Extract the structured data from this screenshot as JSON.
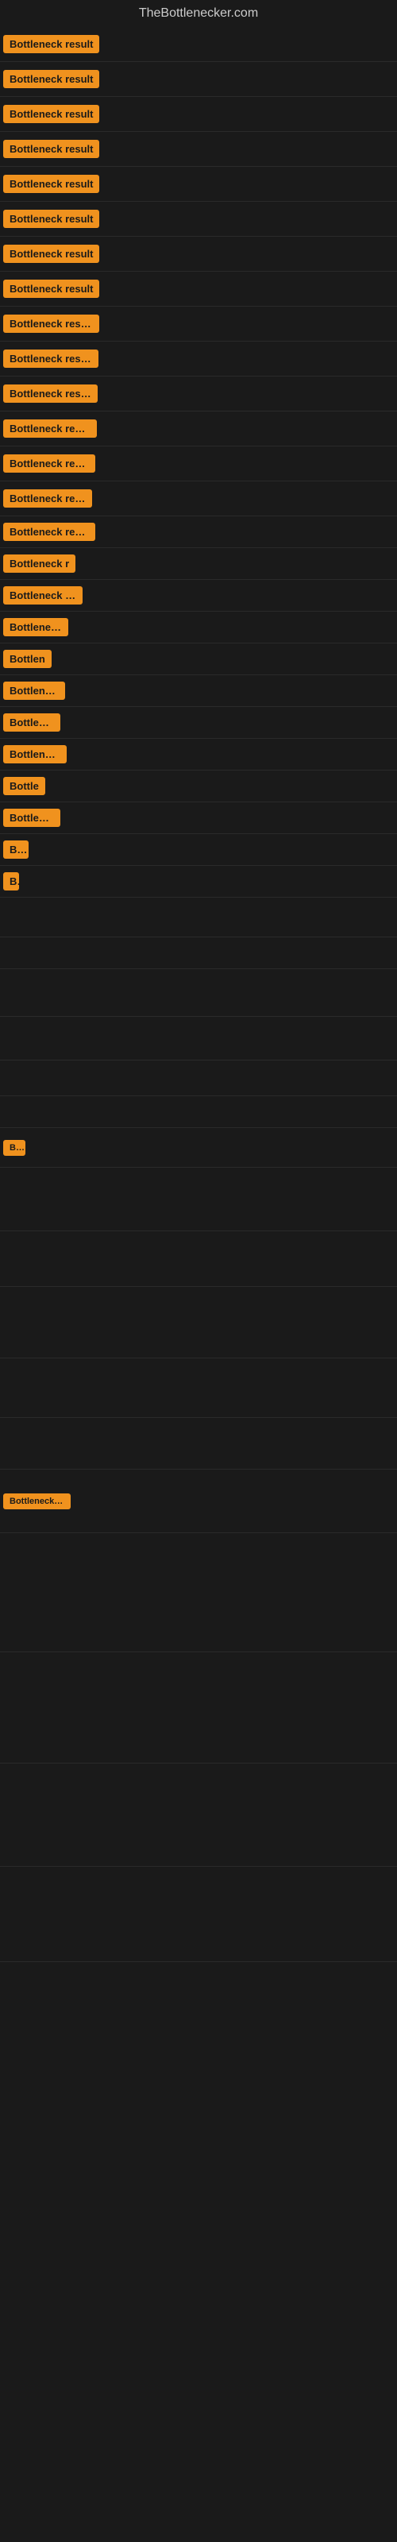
{
  "site": {
    "title": "TheBottlenecker.com"
  },
  "badge": {
    "label": "Bottleneck result",
    "color": "#f0921e"
  },
  "rows": [
    {
      "id": 1,
      "show_badge": true,
      "label": "Bottleneck result"
    },
    {
      "id": 2,
      "show_badge": true,
      "label": "Bottleneck result"
    },
    {
      "id": 3,
      "show_badge": true,
      "label": "Bottleneck result"
    },
    {
      "id": 4,
      "show_badge": true,
      "label": "Bottleneck result"
    },
    {
      "id": 5,
      "show_badge": true,
      "label": "Bottleneck result"
    },
    {
      "id": 6,
      "show_badge": true,
      "label": "Bottleneck result"
    },
    {
      "id": 7,
      "show_badge": true,
      "label": "Bottleneck result"
    },
    {
      "id": 8,
      "show_badge": true,
      "label": "Bottleneck result"
    },
    {
      "id": 9,
      "show_badge": true,
      "label": "Bottleneck result"
    },
    {
      "id": 10,
      "show_badge": true,
      "label": "Bottleneck result"
    },
    {
      "id": 11,
      "show_badge": true,
      "label": "Bottleneck result"
    },
    {
      "id": 12,
      "show_badge": true,
      "label": "Bottleneck result"
    },
    {
      "id": 13,
      "show_badge": true,
      "label": "Bottleneck result"
    },
    {
      "id": 14,
      "show_badge": true,
      "label": "Bottleneck result"
    },
    {
      "id": 15,
      "show_badge": true,
      "label": "Bottleneck result"
    },
    {
      "id": 16,
      "show_badge": true,
      "label": "Bottleneck r"
    },
    {
      "id": 17,
      "show_badge": true,
      "label": "Bottleneck resu"
    },
    {
      "id": 18,
      "show_badge": true,
      "label": "Bottleneck"
    },
    {
      "id": 19,
      "show_badge": true,
      "label": "Bottlen"
    },
    {
      "id": 20,
      "show_badge": true,
      "label": "Bottleneck"
    },
    {
      "id": 21,
      "show_badge": true,
      "label": "Bottlenec"
    },
    {
      "id": 22,
      "show_badge": true,
      "label": "Bottleneck r"
    },
    {
      "id": 23,
      "show_badge": true,
      "label": "Bottle"
    },
    {
      "id": 24,
      "show_badge": true,
      "label": "Bottleneck"
    },
    {
      "id": 25,
      "show_badge": true,
      "label": "Bo"
    },
    {
      "id": 26,
      "show_badge": true,
      "label": "B"
    },
    {
      "id": 27,
      "show_badge": false,
      "label": ""
    },
    {
      "id": 28,
      "show_badge": false,
      "label": ""
    },
    {
      "id": 29,
      "show_badge": false,
      "label": ""
    },
    {
      "id": 30,
      "show_badge": false,
      "label": ""
    },
    {
      "id": 31,
      "show_badge": false,
      "label": ""
    },
    {
      "id": 32,
      "show_badge": false,
      "label": ""
    },
    {
      "id": 33,
      "show_badge": true,
      "label": "Bo"
    },
    {
      "id": 34,
      "show_badge": false,
      "label": ""
    },
    {
      "id": 35,
      "show_badge": false,
      "label": ""
    },
    {
      "id": 36,
      "show_badge": false,
      "label": ""
    },
    {
      "id": 37,
      "show_badge": false,
      "label": ""
    },
    {
      "id": 38,
      "show_badge": false,
      "label": ""
    },
    {
      "id": 39,
      "show_badge": true,
      "label": "Bottleneck re"
    },
    {
      "id": 40,
      "show_badge": false,
      "label": ""
    },
    {
      "id": 41,
      "show_badge": false,
      "label": ""
    },
    {
      "id": 42,
      "show_badge": false,
      "label": ""
    },
    {
      "id": 43,
      "show_badge": false,
      "label": ""
    }
  ]
}
